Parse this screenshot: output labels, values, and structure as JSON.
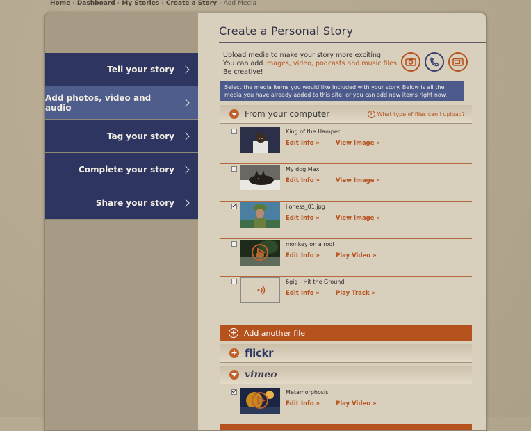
{
  "breadcrumb": {
    "items": [
      "Home",
      "Dashboard",
      "My Stories",
      "Create a Story"
    ],
    "current": "Add Media",
    "separator": "›"
  },
  "sidebar": {
    "items": [
      {
        "label": "Tell your story"
      },
      {
        "label": "Add photos, video and audio"
      },
      {
        "label": "Tag your story"
      },
      {
        "label": "Complete your story"
      },
      {
        "label": "Share your story"
      }
    ],
    "active_index": 1
  },
  "page": {
    "title": "Create a Personal Story",
    "intro_line1": "Upload media to make your story more exciting.",
    "intro_line2_prefix": "You can add ",
    "intro_line2_accent": "images, video, podcasts and music files.",
    "intro_line3": "Be creative!",
    "notice": "Select the media items you would like included with your story. Below is all the media you have already added to this site, or you can add new items right now."
  },
  "media_icons": [
    "camera-icon",
    "phone-icon",
    "tv-icon"
  ],
  "sections": {
    "computer": {
      "label": "From your computer",
      "help": "What type of files can I upload?"
    },
    "add_file": "Add another file",
    "flickr": "flickr",
    "vimeo": "vimeo"
  },
  "media": [
    {
      "name": "King of the Hamper",
      "edit": "Edit Info »",
      "action": "View Image »",
      "checked": false
    },
    {
      "name": "My dog Max",
      "edit": "Edit Info »",
      "action": "View Image »",
      "checked": false
    },
    {
      "name": "lioness_01.jpg",
      "edit": "Edit Info »",
      "action": "View Image »",
      "checked": true
    },
    {
      "name": "monkey on a roof",
      "edit": "Edit Info »",
      "action": "Play Video »",
      "checked": false
    },
    {
      "name": "6gig - Hit the Ground",
      "edit": "Edit Info »",
      "action": "Play Track »",
      "checked": false
    }
  ],
  "vimeo_media": [
    {
      "name": "Metamorphosis",
      "edit": "Edit Info »",
      "action": "Play Video »",
      "checked": true
    }
  ],
  "colors": {
    "accent": "#b5521e",
    "navy": "#2e3560",
    "nav_active": "#4f5d8c",
    "content_bg": "#d9cfbd"
  }
}
